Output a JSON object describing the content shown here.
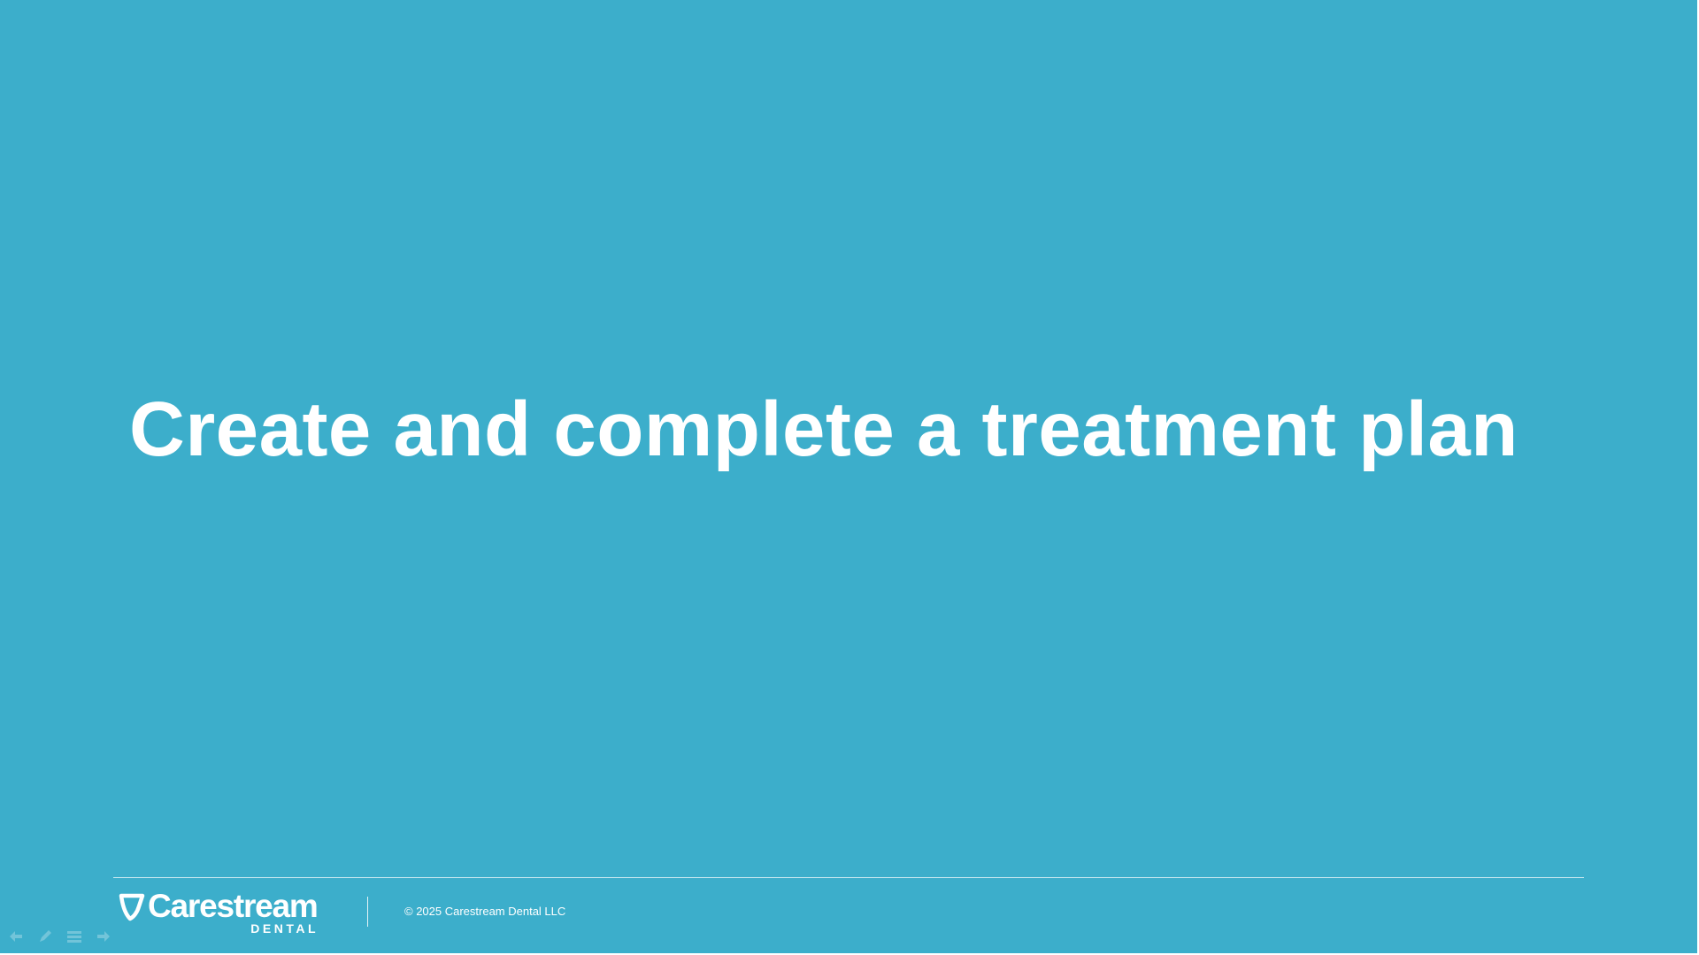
{
  "slide": {
    "title": "Create and complete a treatment plan",
    "background_color": "#3caecb"
  },
  "footer": {
    "logo": {
      "wordmark": "Carestream",
      "subtitle": "DENTAL",
      "icon": "carestream-tooth-logo-icon"
    },
    "copyright": "© 2025 Carestream Dental LLC"
  },
  "nav_controls": [
    {
      "icon": "arrow-left-icon"
    },
    {
      "icon": "pen-icon"
    },
    {
      "icon": "menu-icon"
    },
    {
      "icon": "arrow-right-icon"
    }
  ]
}
